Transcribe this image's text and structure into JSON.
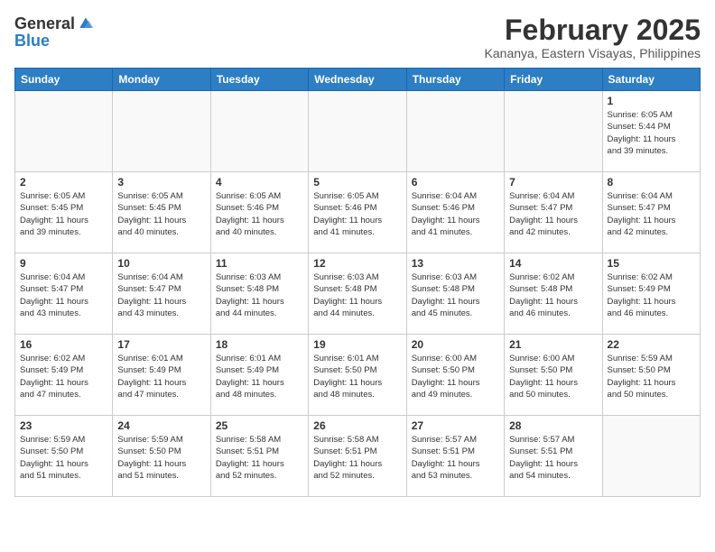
{
  "header": {
    "logo_general": "General",
    "logo_blue": "Blue",
    "month_year": "February 2025",
    "location": "Kananya, Eastern Visayas, Philippines"
  },
  "weekdays": [
    "Sunday",
    "Monday",
    "Tuesday",
    "Wednesday",
    "Thursday",
    "Friday",
    "Saturday"
  ],
  "weeks": [
    [
      {
        "day": "",
        "info": ""
      },
      {
        "day": "",
        "info": ""
      },
      {
        "day": "",
        "info": ""
      },
      {
        "day": "",
        "info": ""
      },
      {
        "day": "",
        "info": ""
      },
      {
        "day": "",
        "info": ""
      },
      {
        "day": "1",
        "info": "Sunrise: 6:05 AM\nSunset: 5:44 PM\nDaylight: 11 hours\nand 39 minutes."
      }
    ],
    [
      {
        "day": "2",
        "info": "Sunrise: 6:05 AM\nSunset: 5:45 PM\nDaylight: 11 hours\nand 39 minutes."
      },
      {
        "day": "3",
        "info": "Sunrise: 6:05 AM\nSunset: 5:45 PM\nDaylight: 11 hours\nand 40 minutes."
      },
      {
        "day": "4",
        "info": "Sunrise: 6:05 AM\nSunset: 5:46 PM\nDaylight: 11 hours\nand 40 minutes."
      },
      {
        "day": "5",
        "info": "Sunrise: 6:05 AM\nSunset: 5:46 PM\nDaylight: 11 hours\nand 41 minutes."
      },
      {
        "day": "6",
        "info": "Sunrise: 6:04 AM\nSunset: 5:46 PM\nDaylight: 11 hours\nand 41 minutes."
      },
      {
        "day": "7",
        "info": "Sunrise: 6:04 AM\nSunset: 5:47 PM\nDaylight: 11 hours\nand 42 minutes."
      },
      {
        "day": "8",
        "info": "Sunrise: 6:04 AM\nSunset: 5:47 PM\nDaylight: 11 hours\nand 42 minutes."
      }
    ],
    [
      {
        "day": "9",
        "info": "Sunrise: 6:04 AM\nSunset: 5:47 PM\nDaylight: 11 hours\nand 43 minutes."
      },
      {
        "day": "10",
        "info": "Sunrise: 6:04 AM\nSunset: 5:47 PM\nDaylight: 11 hours\nand 43 minutes."
      },
      {
        "day": "11",
        "info": "Sunrise: 6:03 AM\nSunset: 5:48 PM\nDaylight: 11 hours\nand 44 minutes."
      },
      {
        "day": "12",
        "info": "Sunrise: 6:03 AM\nSunset: 5:48 PM\nDaylight: 11 hours\nand 44 minutes."
      },
      {
        "day": "13",
        "info": "Sunrise: 6:03 AM\nSunset: 5:48 PM\nDaylight: 11 hours\nand 45 minutes."
      },
      {
        "day": "14",
        "info": "Sunrise: 6:02 AM\nSunset: 5:48 PM\nDaylight: 11 hours\nand 46 minutes."
      },
      {
        "day": "15",
        "info": "Sunrise: 6:02 AM\nSunset: 5:49 PM\nDaylight: 11 hours\nand 46 minutes."
      }
    ],
    [
      {
        "day": "16",
        "info": "Sunrise: 6:02 AM\nSunset: 5:49 PM\nDaylight: 11 hours\nand 47 minutes."
      },
      {
        "day": "17",
        "info": "Sunrise: 6:01 AM\nSunset: 5:49 PM\nDaylight: 11 hours\nand 47 minutes."
      },
      {
        "day": "18",
        "info": "Sunrise: 6:01 AM\nSunset: 5:49 PM\nDaylight: 11 hours\nand 48 minutes."
      },
      {
        "day": "19",
        "info": "Sunrise: 6:01 AM\nSunset: 5:50 PM\nDaylight: 11 hours\nand 48 minutes."
      },
      {
        "day": "20",
        "info": "Sunrise: 6:00 AM\nSunset: 5:50 PM\nDaylight: 11 hours\nand 49 minutes."
      },
      {
        "day": "21",
        "info": "Sunrise: 6:00 AM\nSunset: 5:50 PM\nDaylight: 11 hours\nand 50 minutes."
      },
      {
        "day": "22",
        "info": "Sunrise: 5:59 AM\nSunset: 5:50 PM\nDaylight: 11 hours\nand 50 minutes."
      }
    ],
    [
      {
        "day": "23",
        "info": "Sunrise: 5:59 AM\nSunset: 5:50 PM\nDaylight: 11 hours\nand 51 minutes."
      },
      {
        "day": "24",
        "info": "Sunrise: 5:59 AM\nSunset: 5:50 PM\nDaylight: 11 hours\nand 51 minutes."
      },
      {
        "day": "25",
        "info": "Sunrise: 5:58 AM\nSunset: 5:51 PM\nDaylight: 11 hours\nand 52 minutes."
      },
      {
        "day": "26",
        "info": "Sunrise: 5:58 AM\nSunset: 5:51 PM\nDaylight: 11 hours\nand 52 minutes."
      },
      {
        "day": "27",
        "info": "Sunrise: 5:57 AM\nSunset: 5:51 PM\nDaylight: 11 hours\nand 53 minutes."
      },
      {
        "day": "28",
        "info": "Sunrise: 5:57 AM\nSunset: 5:51 PM\nDaylight: 11 hours\nand 54 minutes."
      },
      {
        "day": "",
        "info": ""
      }
    ]
  ]
}
